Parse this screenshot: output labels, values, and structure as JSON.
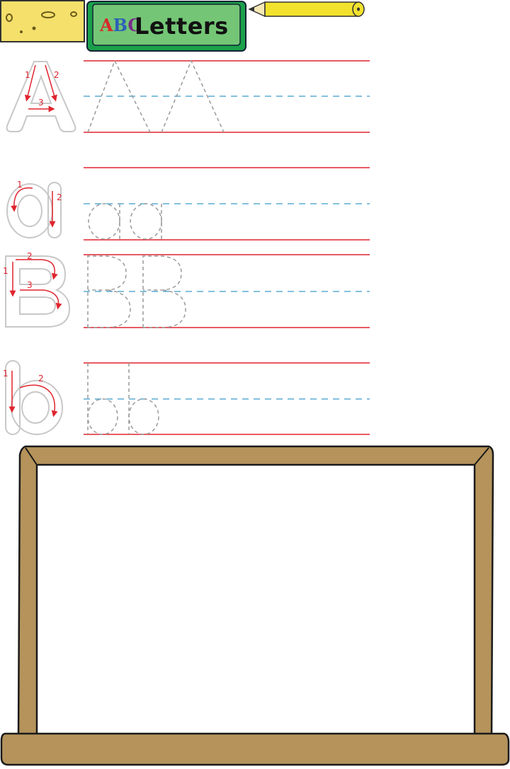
{
  "header": {
    "logo_letters": [
      "A",
      "B",
      "C"
    ],
    "title": "Letters",
    "colors": {
      "plate": "#1aa04a",
      "plate_inner": "#74c676",
      "sponge": "#f4e06b",
      "pencil": "#f2e22e"
    }
  },
  "icons": {
    "sponge": "eraser-sponge-icon",
    "pencil": "pencil-icon"
  },
  "rows": [
    {
      "letter": "A",
      "case": "uppercase",
      "stroke_numbers": [
        "1",
        "2",
        "3"
      ],
      "trace_count": 2
    },
    {
      "letter": "a",
      "case": "lowercase",
      "stroke_numbers": [
        "1",
        "2"
      ],
      "trace_count": 2
    },
    {
      "letter": "B",
      "case": "uppercase",
      "stroke_numbers": [
        "2",
        "1",
        "3"
      ],
      "trace_count": 2
    },
    {
      "letter": "b",
      "case": "lowercase",
      "stroke_numbers": [
        "1",
        "2"
      ],
      "trace_count": 2
    }
  ],
  "guide_colors": {
    "solid": "#e0242e",
    "dashed": "#3a9bc9",
    "trace": "#9a9a9a",
    "outline": "#c8c8c8",
    "arrow": "#e0242e"
  },
  "board": {
    "frame_color": "#b5935b",
    "surface_color": "#ffffff"
  }
}
